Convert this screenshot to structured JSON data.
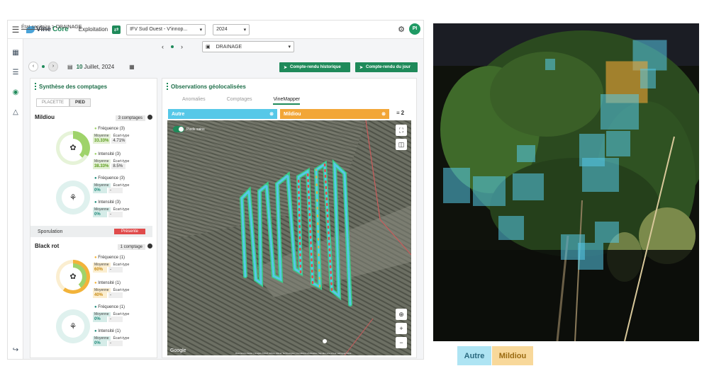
{
  "app": {
    "name_a": "Vine",
    "name_b": "Core",
    "exploitation_label": "Exploitation",
    "exploitation_select": "IFV Sud Ouest - V'innop...",
    "year_select": "2024",
    "avatar_initials": "PI",
    "icons": [
      "menu-icon",
      "dashboard-icon",
      "layers-icon",
      "map-pin-icon",
      "flask-icon",
      "logout-icon",
      "settings-icon"
    ]
  },
  "breadcrumb": {
    "parent": "État sanitaire",
    "current": "DRAINAGE"
  },
  "parcel_select": "DRAINAGE",
  "date": {
    "day": "10",
    "rest": "Juillet, 2024"
  },
  "buttons": {
    "history": "Compte-rendu historique",
    "today": "Compte-rendu du jour"
  },
  "synthesis": {
    "title": "Synthèse des comptages",
    "tabs": [
      "PLACETTE",
      "PIED"
    ],
    "mildiou": {
      "name": "Mildiou",
      "count": "3 comptages",
      "blocks": [
        {
          "label": "Fréquence (3)",
          "avg_label": "Moyenne",
          "sd_label": "Écart-type",
          "avg": "33.33%",
          "sd": "4.71%"
        },
        {
          "label": "Intensité (3)",
          "avg_label": "Moyenne",
          "sd_label": "Écart-type",
          "avg": "38.33%",
          "sd": "8.5%"
        },
        {
          "label": "Fréquence (3)",
          "avg_label": "Moyenne",
          "sd_label": "Écart-type",
          "avg": "0%",
          "sd": "-"
        },
        {
          "label": "Intensité (3)",
          "avg_label": "Moyenne",
          "sd_label": "Écart-type",
          "avg": "0%",
          "sd": "-"
        }
      ]
    },
    "sporulation": {
      "label": "Sporulation",
      "status": "Présente"
    },
    "blackrot": {
      "name": "Black rot",
      "count": "1 comptage",
      "blocks": [
        {
          "label": "Fréquence (1)",
          "avg_label": "Moyenne",
          "sd_label": "Écart-type",
          "avg": "60%",
          "sd": "-"
        },
        {
          "label": "Intensité (1)",
          "avg_label": "Moyenne",
          "sd_label": "Écart-type",
          "avg": "40%",
          "sd": "-"
        },
        {
          "label": "Fréquence (1)",
          "avg_label": "Moyenne",
          "sd_label": "Écart-type",
          "avg": "0%",
          "sd": "-"
        },
        {
          "label": "Intensité (1)",
          "avg_label": "Moyenne",
          "sd_label": "Écart-type",
          "avg": "0%",
          "sd": "-"
        }
      ]
    }
  },
  "observations": {
    "title": "Observations géolocalisées",
    "tabs": [
      "Anomalies",
      "Comptages",
      "VineMapper"
    ],
    "active_tab": "VineMapper",
    "filter_autre": "Autre",
    "filter_mildiou": "Mildiou",
    "filter_count": "2",
    "toggle_label": "Pieds sains",
    "map_credit": "Google",
    "map_attrib": "Raccourcis clavier | Images ©2024 Airbus, Maxar Technologies | Conditions d'utilisation   Signaler une erreur cartographique"
  },
  "legend": {
    "autre": "Autre",
    "mildiou": "Mildiou"
  },
  "colors": {
    "green": "#1f8a5a",
    "cyan": "#56c8e8",
    "orange": "#f2a637",
    "red": "#e04b4b"
  }
}
